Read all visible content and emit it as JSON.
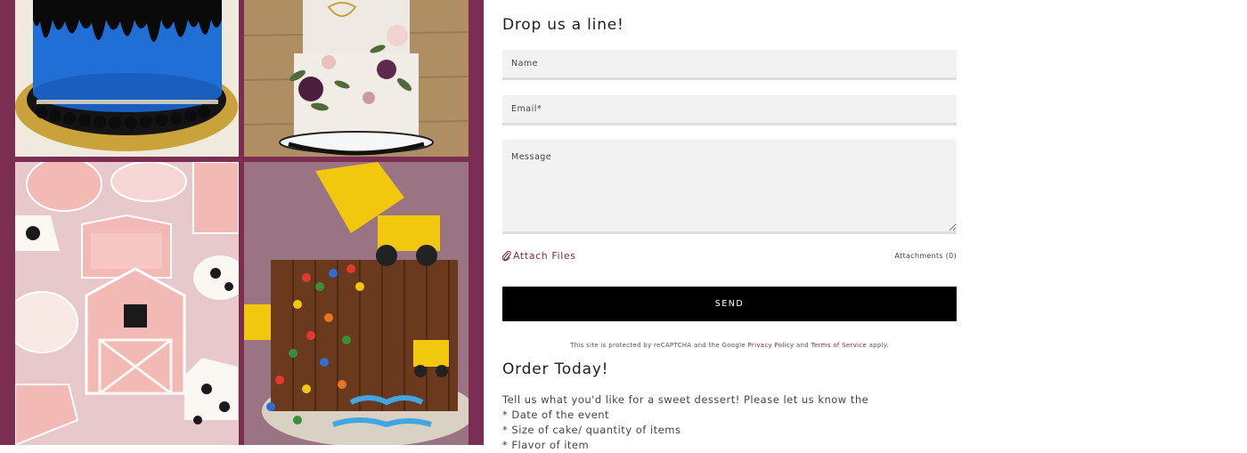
{
  "gallery": {
    "images": [
      {
        "name": "blue-drip-cake-photo",
        "colors": {
          "bg": "#e8e1d6",
          "cake": "#1f6fd6",
          "drip": "#0a0a0a",
          "board": "#c9a23a"
        }
      },
      {
        "name": "floral-tiered-cake-photo",
        "colors": {
          "bg": "#a9875f",
          "cake": "#eeeae3",
          "flowers": "#4b1f3d",
          "leaves": "#4f6b3a"
        }
      },
      {
        "name": "cow-cookies-photo",
        "colors": {
          "bg": "#e7c9cc",
          "cookie": "#f3b9b5",
          "spots": "#1a1a1a",
          "white": "#fbf7f3"
        }
      },
      {
        "name": "construction-candy-cake-photo",
        "colors": {
          "bg": "#8e6b7a",
          "chocolate": "#6b3a1e",
          "truck": "#f2c80f",
          "frosting": "#40a7e3"
        }
      }
    ]
  },
  "form": {
    "title": "Drop us a line!",
    "name_placeholder": "Name",
    "email_placeholder": "Email*",
    "message_placeholder": "Message",
    "attach_label": "Attach Files",
    "attachments_label": "Attachments (0)",
    "send_label": "SEND",
    "recaptcha": {
      "prefix": "This site is protected by reCAPTCHA and the Google",
      "privacy_link": "Privacy Policy",
      "and": "and",
      "terms_link": "Terms of Service",
      "suffix": "apply."
    }
  },
  "order": {
    "title": "Order Today!",
    "lines": [
      "Tell us what you'd like for a sweet dessert! Please let us know the",
      "* Date of the event",
      "* Size of cake/ quantity of items",
      "* Flavor of item"
    ]
  },
  "colors": {
    "accent": "#7b2d52",
    "panel_bg": "#7b2d52",
    "button_bg": "#000000",
    "field_bg": "#f2f2f2"
  }
}
